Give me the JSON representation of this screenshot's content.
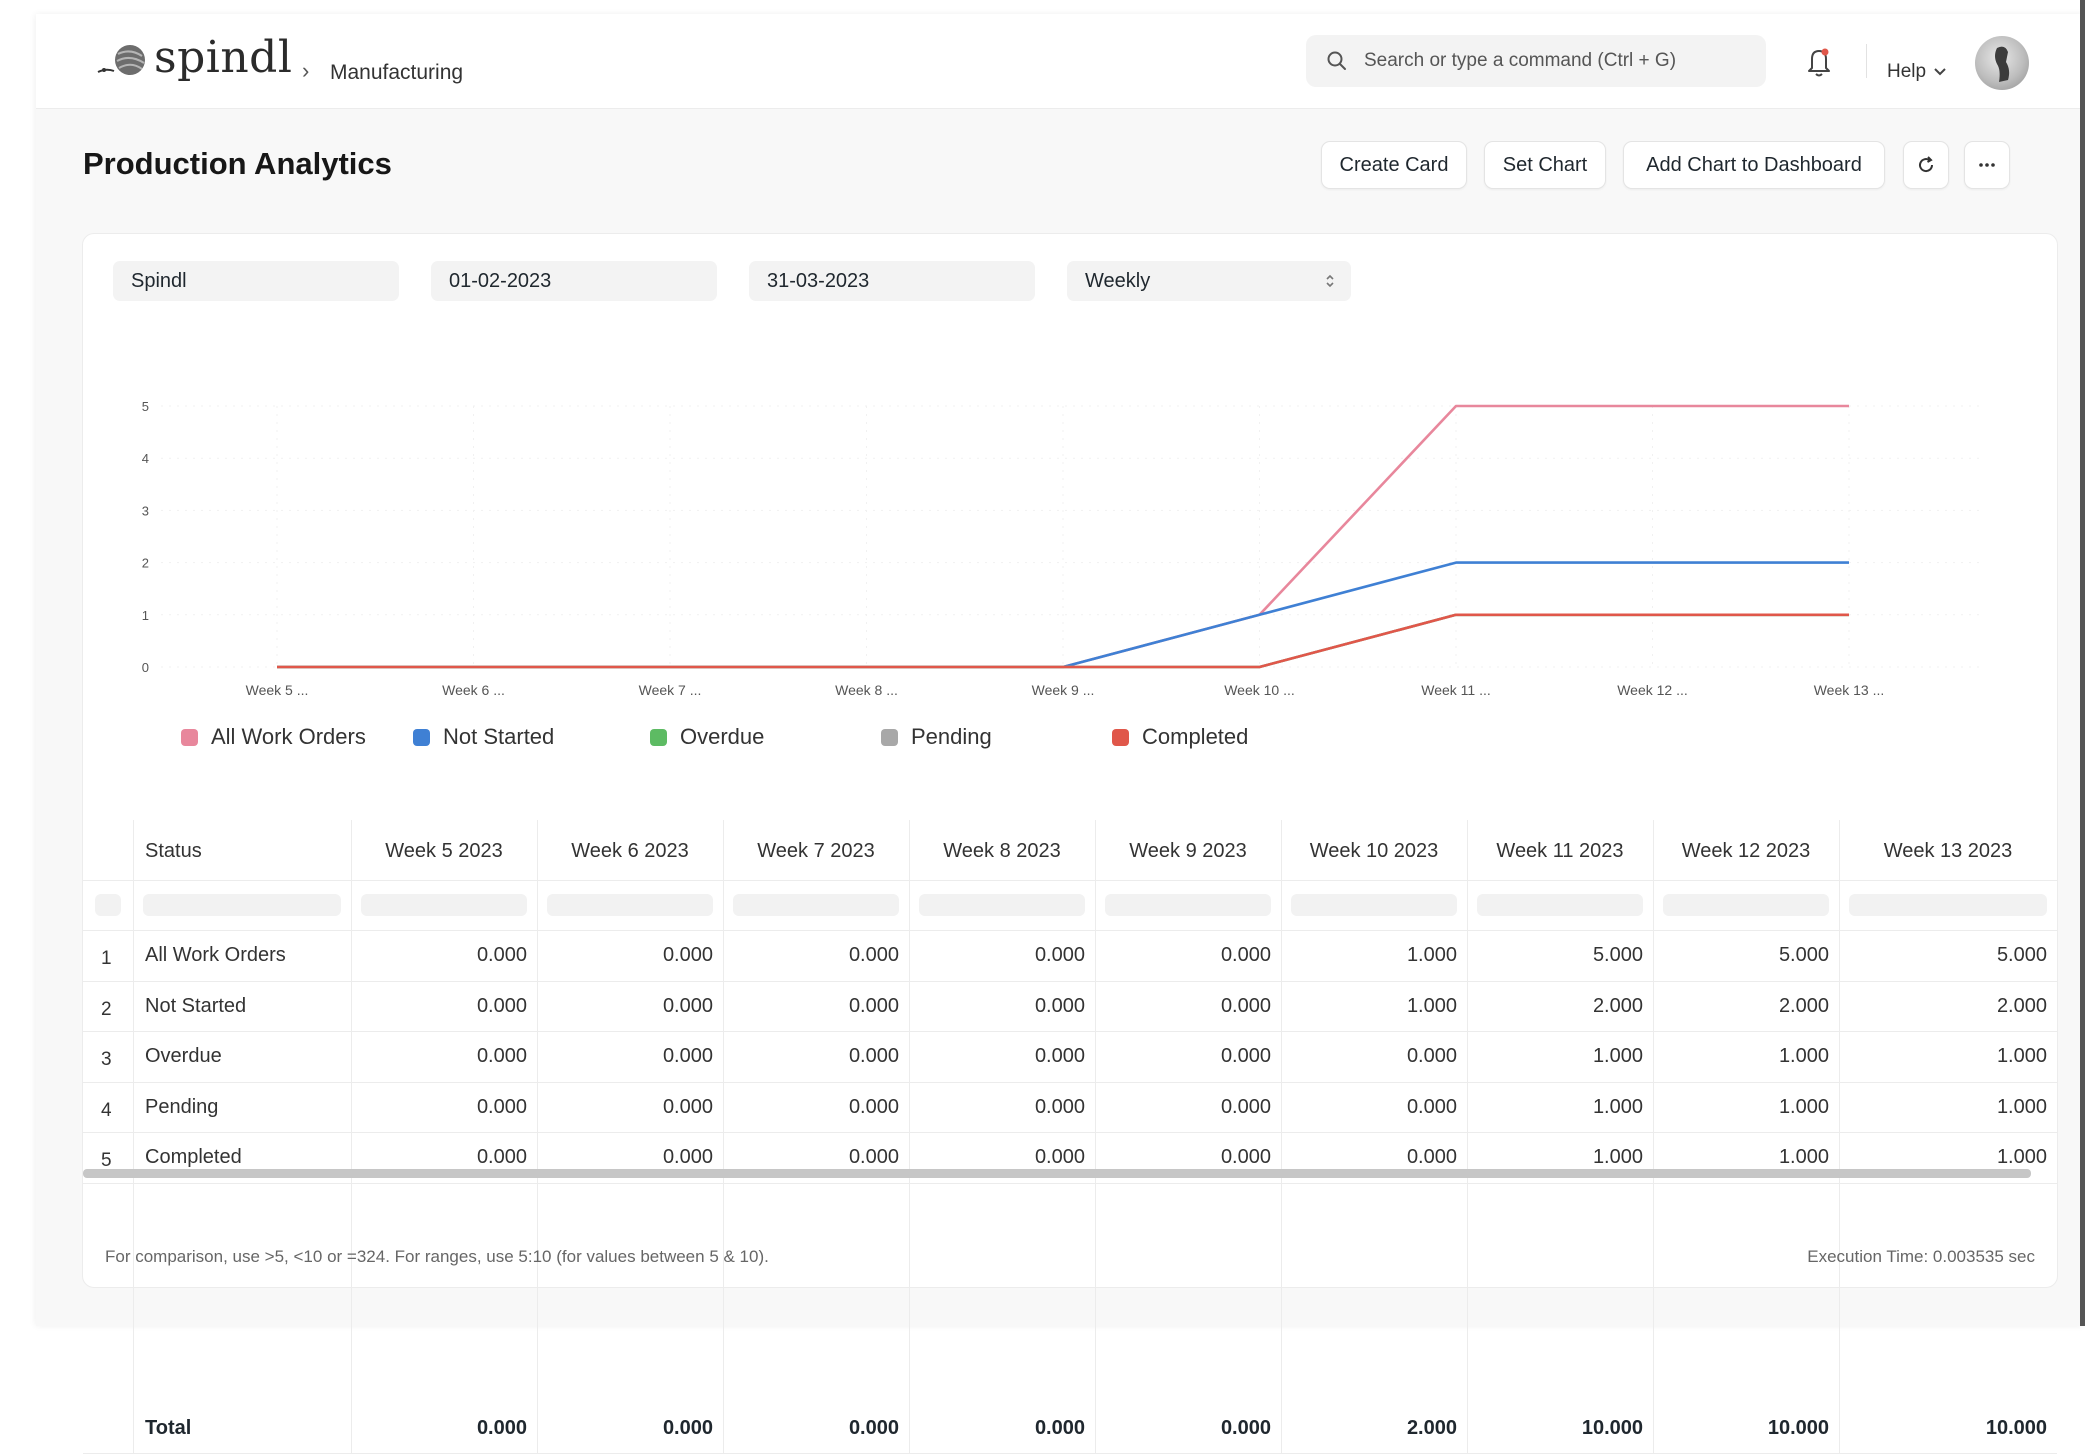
{
  "navbar": {
    "brand": "spindl",
    "breadcrumb": "Manufacturing",
    "search_placeholder": "Search or type a command (Ctrl + G)",
    "help_label": "Help"
  },
  "page": {
    "title": "Production Analytics",
    "buttons": {
      "create_card": "Create Card",
      "set_chart": "Set Chart",
      "add_to_dashboard": "Add Chart to Dashboard"
    }
  },
  "filters": {
    "company": "Spindl",
    "from_date": "01-02-2023",
    "to_date": "31-03-2023",
    "range": "Weekly"
  },
  "chart_data": {
    "type": "line",
    "x": [
      "Week 5 ...",
      "Week 6 ...",
      "Week 7 ...",
      "Week 8 ...",
      "Week 9 ...",
      "Week 10 ...",
      "Week 11 ...",
      "Week 12 ...",
      "Week 13 ..."
    ],
    "ylim": [
      0,
      5
    ],
    "yticks": [
      "0",
      "1",
      "2",
      "3",
      "4",
      "5"
    ],
    "series": [
      {
        "name": "All Work Orders",
        "color": "#e8879c",
        "values": [
          0,
          0,
          0,
          0,
          0,
          1,
          5,
          5,
          5
        ]
      },
      {
        "name": "Not Started",
        "color": "#3f80d4",
        "values": [
          0,
          0,
          0,
          0,
          0,
          1,
          2,
          2,
          2
        ]
      },
      {
        "name": "Overdue",
        "color": "#5dbb63",
        "values": [
          0,
          0,
          0,
          0,
          0,
          0,
          1,
          1,
          1
        ]
      },
      {
        "name": "Pending",
        "color": "#a8a8a8",
        "values": [
          0,
          0,
          0,
          0,
          0,
          0,
          1,
          1,
          1
        ]
      },
      {
        "name": "Completed",
        "color": "#e0574a",
        "values": [
          0,
          0,
          0,
          0,
          0,
          0,
          1,
          1,
          1
        ]
      }
    ],
    "grid": true,
    "legend_position": "bottom-left"
  },
  "table": {
    "columns": [
      "Status",
      "Week 5 2023",
      "Week 6 2023",
      "Week 7 2023",
      "Week 8 2023",
      "Week 9 2023",
      "Week 10 2023",
      "Week 11 2023",
      "Week 12 2023",
      "Week 13 2023"
    ],
    "rows": [
      {
        "n": "1",
        "status": "All Work Orders",
        "values": [
          "0.000",
          "0.000",
          "0.000",
          "0.000",
          "0.000",
          "1.000",
          "5.000",
          "5.000",
          "5.000"
        ]
      },
      {
        "n": "2",
        "status": "Not Started",
        "values": [
          "0.000",
          "0.000",
          "0.000",
          "0.000",
          "0.000",
          "1.000",
          "2.000",
          "2.000",
          "2.000"
        ]
      },
      {
        "n": "3",
        "status": "Overdue",
        "values": [
          "0.000",
          "0.000",
          "0.000",
          "0.000",
          "0.000",
          "0.000",
          "1.000",
          "1.000",
          "1.000"
        ]
      },
      {
        "n": "4",
        "status": "Pending",
        "values": [
          "0.000",
          "0.000",
          "0.000",
          "0.000",
          "0.000",
          "0.000",
          "1.000",
          "1.000",
          "1.000"
        ]
      },
      {
        "n": "5",
        "status": "Completed",
        "values": [
          "0.000",
          "0.000",
          "0.000",
          "0.000",
          "0.000",
          "0.000",
          "1.000",
          "1.000",
          "1.000"
        ]
      }
    ],
    "total": {
      "label": "Total",
      "values": [
        "0.000",
        "0.000",
        "0.000",
        "0.000",
        "0.000",
        "2.000",
        "10.000",
        "10.000",
        "10.000"
      ]
    }
  },
  "footer": {
    "note": "For comparison, use >5, <10 or =324. For ranges, use 5:10 (for values between 5 & 10).",
    "execution_time": "Execution Time: 0.003535 sec"
  }
}
